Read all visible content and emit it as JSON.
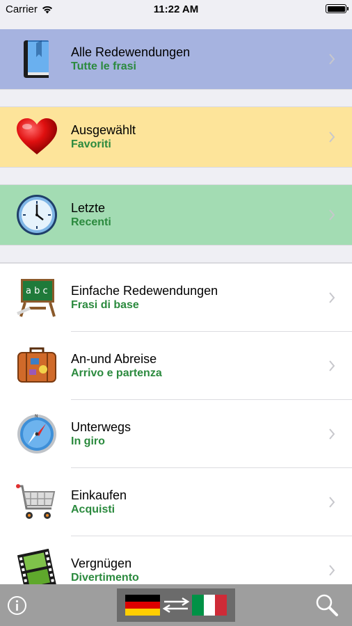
{
  "status_bar": {
    "carrier": "Carrier",
    "time": "11:22 AM"
  },
  "featured": [
    {
      "title": "Alle Redewendungen",
      "subtitle": "Tutte le frasi",
      "bg": "#a6b3e0",
      "icon": "book-icon"
    },
    {
      "title": "Ausgewählt",
      "subtitle": "Favoriti",
      "bg": "#fde49a",
      "icon": "heart-icon"
    },
    {
      "title": "Letzte",
      "subtitle": "Recenti",
      "bg": "#a3dcb3",
      "icon": "clock-icon"
    }
  ],
  "categories": [
    {
      "title": "Einfache Redewendungen",
      "subtitle": "Frasi di base",
      "icon": "chalkboard-icon"
    },
    {
      "title": "An-und Abreise",
      "subtitle": "Arrivo e partenza",
      "icon": "suitcase-icon"
    },
    {
      "title": "Unterwegs",
      "subtitle": "In giro",
      "icon": "compass-icon"
    },
    {
      "title": "Einkaufen",
      "subtitle": "Acquisti",
      "icon": "shopping-cart-icon"
    },
    {
      "title": "Vergnügen",
      "subtitle": "Divertimento",
      "icon": "film-strip-icon"
    }
  ],
  "colors": {
    "subtitle_green": "#2b8a3e",
    "tab_bar": "#9e9e9e"
  },
  "tab_bar": {
    "info_icon": "info-icon",
    "language_switch_icon": "german-italian-flags-swap-icon",
    "search_icon": "magnifier-icon"
  }
}
